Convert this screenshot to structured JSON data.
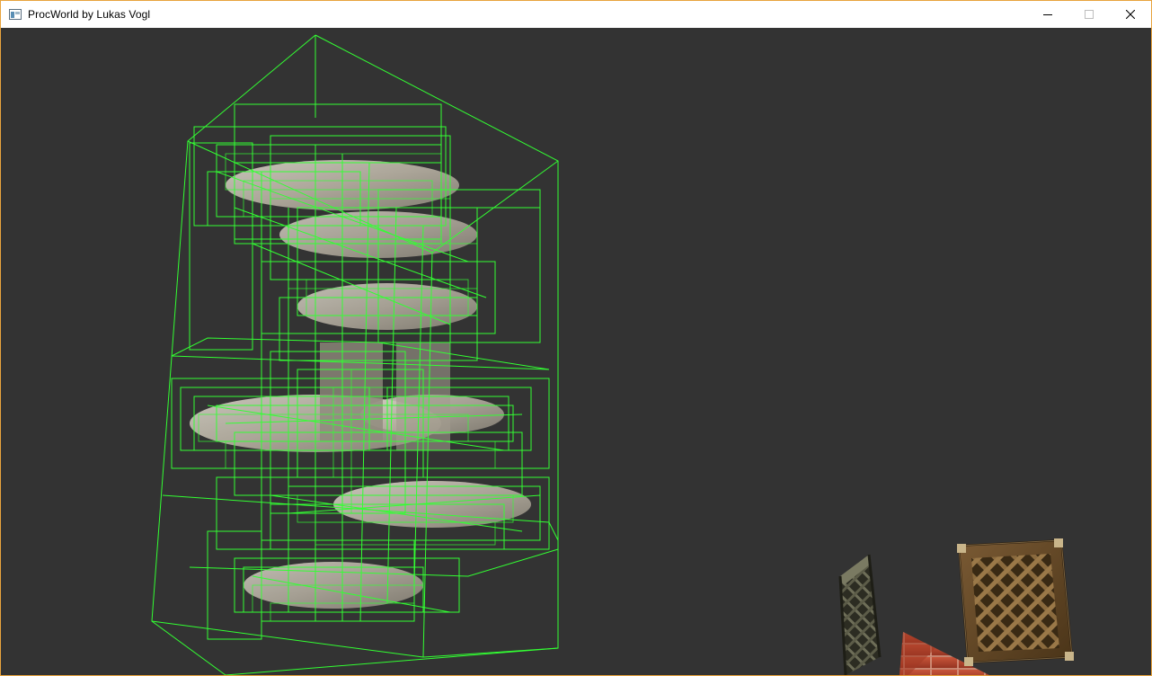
{
  "window": {
    "title": "ProcWorld by Lukas Vogl",
    "controls": [
      "minimize-icon",
      "maximize-icon",
      "close-icon"
    ],
    "border_color": "#e8a33d"
  },
  "scene": {
    "background_color": "#333333",
    "wireframe_color": "#33ff33",
    "objects": [
      "staircase-wireframe",
      "wooden-lattice-crate",
      "dark-lattice-panel",
      "brick-block"
    ]
  }
}
